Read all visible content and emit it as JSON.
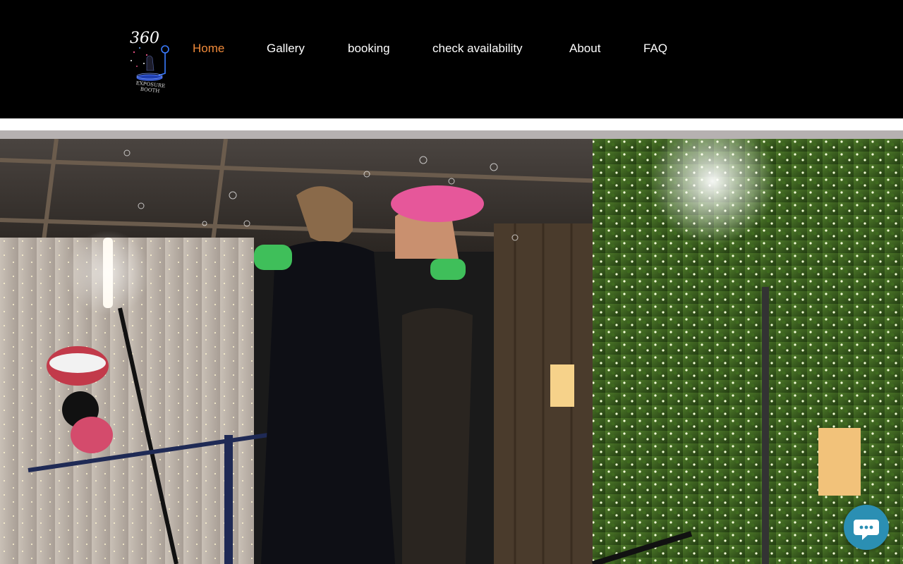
{
  "header": {
    "logo": {
      "icon": "360-exposure-booth-logo",
      "text_top": "360",
      "text_bottom": "EXPOSURE BOOTH"
    },
    "nav": [
      {
        "label": "Home",
        "active": true
      },
      {
        "label": "Gallery",
        "active": false
      },
      {
        "label": "booking",
        "active": false
      },
      {
        "label": "check availability",
        "active": false
      },
      {
        "label": "About",
        "active": false
      },
      {
        "label": "FAQ",
        "active": false
      }
    ]
  },
  "hero": {
    "description_icon": "event-photo"
  },
  "chat": {
    "icon": "chat-bubble-icon"
  },
  "colors": {
    "nav_active": "#f08a3a",
    "nav_text": "#ffffff",
    "header_bg": "#000000",
    "chat_button": "#2b8fb3"
  }
}
